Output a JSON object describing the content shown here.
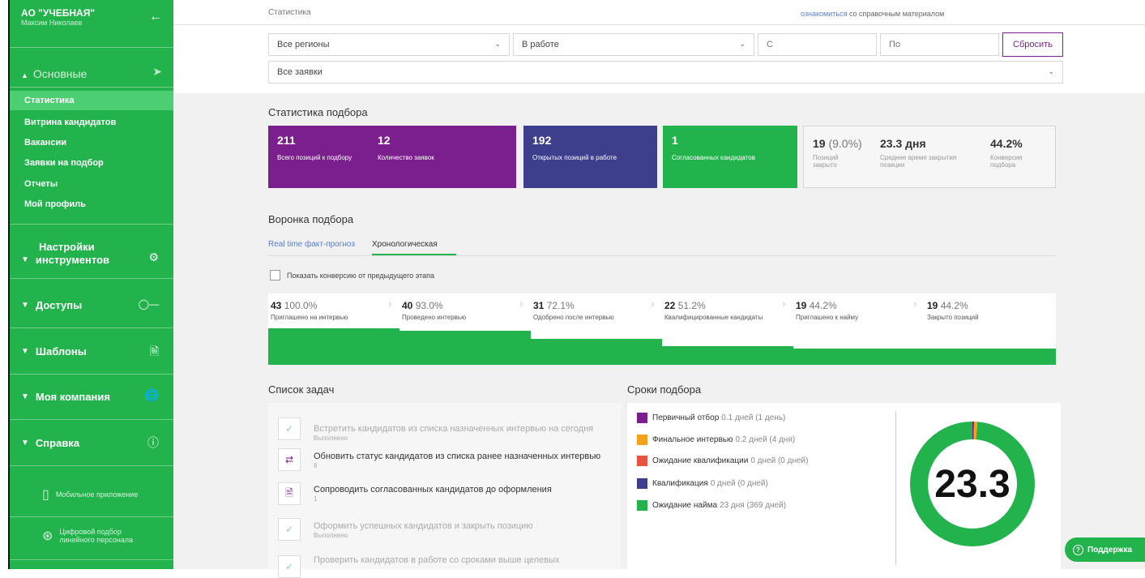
{
  "sidebar": {
    "org": "АО \"УЧЕБНАЯ\"",
    "user": "Максим Николаев",
    "section_main": "Основные",
    "items": [
      {
        "label": "Статистика"
      },
      {
        "label": "Витрина кандидатов"
      },
      {
        "label": "Вакансии"
      },
      {
        "label": "Заявки на подбор"
      },
      {
        "label": "Отчеты"
      },
      {
        "label": "Мой профиль"
      }
    ],
    "settings_line1": "Настройки",
    "settings_line2": "инструментов",
    "access": "Доступы",
    "templates": "Шаблоны",
    "company": "Моя компания",
    "help": "Справка",
    "mobile_app": "Мобильное приложение",
    "digital_line1": "Цифровой подбор",
    "digital_line2": "линейного персонала"
  },
  "header": {
    "breadcrumb": "Статистика",
    "ref_link": "ознакомиться",
    "ref_text": " со справочным материалом"
  },
  "filters": {
    "region": "Все регионы",
    "status": "В работе",
    "from_placeholder": "С",
    "to_placeholder": "По",
    "reset": "Сбросить",
    "requests": "Все заявки"
  },
  "stats": {
    "title": "Статистика подбора",
    "cards": [
      {
        "num": "211",
        "label": "Всего позиций к подбору"
      },
      {
        "num": "12",
        "label": "Количество заявок"
      },
      {
        "num": "192",
        "label": "Открытых позиций в работе"
      },
      {
        "num": "1",
        "label": "Согласованных кандидатов"
      }
    ],
    "closed_num": "19",
    "closed_pct": " (9.0%)",
    "closed_label_1": "Позиций",
    "closed_label_2": "закрыто",
    "avg_time": "23.3 дня",
    "avg_label_1": "Среднее время закрытия",
    "avg_label_2": "позиции",
    "conversion": "44.2%",
    "conv_label_1": "Конверсия",
    "conv_label_2": "подбора",
    "colors": {
      "purple": "#7b1f8f",
      "indigo": "#3d3f8d",
      "green": "#22b34c"
    }
  },
  "funnel": {
    "title": "Воронка подбора",
    "tab_realtime": "Real time факт-прогноз",
    "tab_chrono": "Хронологическая",
    "checkbox_label": "Показать конверсию от предыдущего этапа",
    "stages": [
      {
        "value": "43",
        "pct": "100.0%",
        "label": "Приглашено на интервью",
        "level": 1.0
      },
      {
        "value": "40",
        "pct": "93.0%",
        "label": "Проведено интервью",
        "level": 0.93
      },
      {
        "value": "31",
        "pct": "72.1%",
        "label": "Одобрено после интервью",
        "level": 0.721
      },
      {
        "value": "22",
        "pct": "51.2%",
        "label": "Квалифицированные кандидаты",
        "level": 0.512
      },
      {
        "value": "19",
        "pct": "44.2%",
        "label": "Приглашено к найму",
        "level": 0.442
      },
      {
        "value": "19",
        "pct": "44.2%",
        "label": "Закрыто позиций",
        "level": 0.442
      }
    ]
  },
  "tasks": {
    "title": "Список задач",
    "items": [
      {
        "text": "Встретить кандидатов из списка назначенных интервью на сегодня",
        "sub": "Выполнено",
        "done": true
      },
      {
        "text": "Обновить статус кандидатов из списка ранее назначенных интервью",
        "sub": "8",
        "done": false
      },
      {
        "text": "Сопроводить согласованных кандидатов до оформления",
        "sub": "1",
        "done": false
      },
      {
        "text": "Оформить успешных кандидатов и закрыть позицию",
        "sub": "Выполнено",
        "done": true
      },
      {
        "text": "Проверить кандидатов в работе со сроками выше целевых",
        "sub": "",
        "done": true
      }
    ]
  },
  "timing": {
    "title": "Сроки подбора",
    "legend": [
      {
        "name": "Первичный отбор",
        "value": "0.1 дней (1 день)",
        "color": "#7b1f8f"
      },
      {
        "name": "Финальное интервью",
        "value": "0.2 дней (4 дня)",
        "color": "#f4a21c"
      },
      {
        "name": "Ожидание квалификации",
        "value": "0 дней (0 дней)",
        "color": "#e8553e"
      },
      {
        "name": "Квалификация",
        "value": "0 дней (0 дней)",
        "color": "#3d3f8d"
      },
      {
        "name": "Ожидание найма",
        "value": "23 дня (369 дней)",
        "color": "#22b34c"
      }
    ],
    "total": "23.3",
    "segments": [
      0.1,
      0.2,
      0.0,
      0.0,
      23.0
    ]
  },
  "support": {
    "label": "Поддержка"
  }
}
